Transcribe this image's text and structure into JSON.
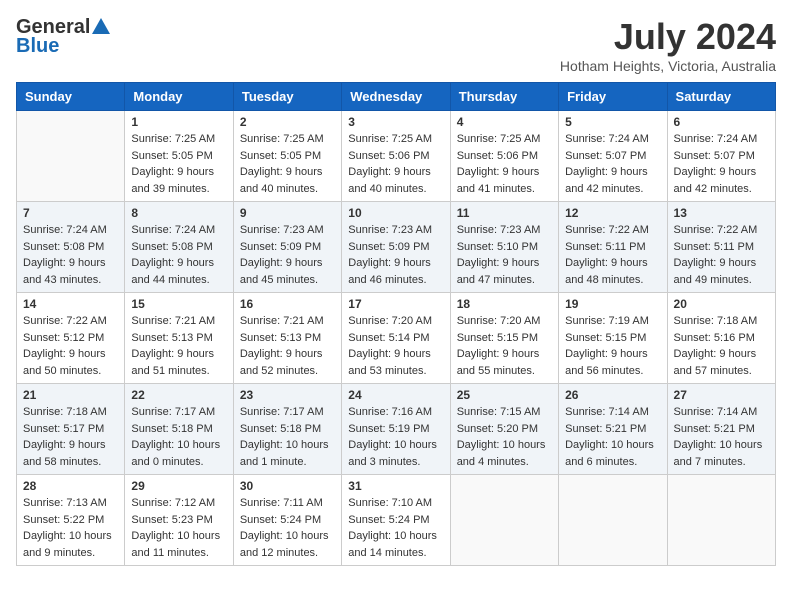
{
  "header": {
    "logo_general": "General",
    "logo_blue": "Blue",
    "month_year": "July 2024",
    "location": "Hotham Heights, Victoria, Australia"
  },
  "days_of_week": [
    "Sunday",
    "Monday",
    "Tuesday",
    "Wednesday",
    "Thursday",
    "Friday",
    "Saturday"
  ],
  "weeks": [
    [
      {
        "day": "",
        "info": ""
      },
      {
        "day": "1",
        "info": "Sunrise: 7:25 AM\nSunset: 5:05 PM\nDaylight: 9 hours\nand 39 minutes."
      },
      {
        "day": "2",
        "info": "Sunrise: 7:25 AM\nSunset: 5:05 PM\nDaylight: 9 hours\nand 40 minutes."
      },
      {
        "day": "3",
        "info": "Sunrise: 7:25 AM\nSunset: 5:06 PM\nDaylight: 9 hours\nand 40 minutes."
      },
      {
        "day": "4",
        "info": "Sunrise: 7:25 AM\nSunset: 5:06 PM\nDaylight: 9 hours\nand 41 minutes."
      },
      {
        "day": "5",
        "info": "Sunrise: 7:24 AM\nSunset: 5:07 PM\nDaylight: 9 hours\nand 42 minutes."
      },
      {
        "day": "6",
        "info": "Sunrise: 7:24 AM\nSunset: 5:07 PM\nDaylight: 9 hours\nand 42 minutes."
      }
    ],
    [
      {
        "day": "7",
        "info": "Sunrise: 7:24 AM\nSunset: 5:08 PM\nDaylight: 9 hours\nand 43 minutes."
      },
      {
        "day": "8",
        "info": "Sunrise: 7:24 AM\nSunset: 5:08 PM\nDaylight: 9 hours\nand 44 minutes."
      },
      {
        "day": "9",
        "info": "Sunrise: 7:23 AM\nSunset: 5:09 PM\nDaylight: 9 hours\nand 45 minutes."
      },
      {
        "day": "10",
        "info": "Sunrise: 7:23 AM\nSunset: 5:09 PM\nDaylight: 9 hours\nand 46 minutes."
      },
      {
        "day": "11",
        "info": "Sunrise: 7:23 AM\nSunset: 5:10 PM\nDaylight: 9 hours\nand 47 minutes."
      },
      {
        "day": "12",
        "info": "Sunrise: 7:22 AM\nSunset: 5:11 PM\nDaylight: 9 hours\nand 48 minutes."
      },
      {
        "day": "13",
        "info": "Sunrise: 7:22 AM\nSunset: 5:11 PM\nDaylight: 9 hours\nand 49 minutes."
      }
    ],
    [
      {
        "day": "14",
        "info": "Sunrise: 7:22 AM\nSunset: 5:12 PM\nDaylight: 9 hours\nand 50 minutes."
      },
      {
        "day": "15",
        "info": "Sunrise: 7:21 AM\nSunset: 5:13 PM\nDaylight: 9 hours\nand 51 minutes."
      },
      {
        "day": "16",
        "info": "Sunrise: 7:21 AM\nSunset: 5:13 PM\nDaylight: 9 hours\nand 52 minutes."
      },
      {
        "day": "17",
        "info": "Sunrise: 7:20 AM\nSunset: 5:14 PM\nDaylight: 9 hours\nand 53 minutes."
      },
      {
        "day": "18",
        "info": "Sunrise: 7:20 AM\nSunset: 5:15 PM\nDaylight: 9 hours\nand 55 minutes."
      },
      {
        "day": "19",
        "info": "Sunrise: 7:19 AM\nSunset: 5:15 PM\nDaylight: 9 hours\nand 56 minutes."
      },
      {
        "day": "20",
        "info": "Sunrise: 7:18 AM\nSunset: 5:16 PM\nDaylight: 9 hours\nand 57 minutes."
      }
    ],
    [
      {
        "day": "21",
        "info": "Sunrise: 7:18 AM\nSunset: 5:17 PM\nDaylight: 9 hours\nand 58 minutes."
      },
      {
        "day": "22",
        "info": "Sunrise: 7:17 AM\nSunset: 5:18 PM\nDaylight: 10 hours\nand 0 minutes."
      },
      {
        "day": "23",
        "info": "Sunrise: 7:17 AM\nSunset: 5:18 PM\nDaylight: 10 hours\nand 1 minute."
      },
      {
        "day": "24",
        "info": "Sunrise: 7:16 AM\nSunset: 5:19 PM\nDaylight: 10 hours\nand 3 minutes."
      },
      {
        "day": "25",
        "info": "Sunrise: 7:15 AM\nSunset: 5:20 PM\nDaylight: 10 hours\nand 4 minutes."
      },
      {
        "day": "26",
        "info": "Sunrise: 7:14 AM\nSunset: 5:21 PM\nDaylight: 10 hours\nand 6 minutes."
      },
      {
        "day": "27",
        "info": "Sunrise: 7:14 AM\nSunset: 5:21 PM\nDaylight: 10 hours\nand 7 minutes."
      }
    ],
    [
      {
        "day": "28",
        "info": "Sunrise: 7:13 AM\nSunset: 5:22 PM\nDaylight: 10 hours\nand 9 minutes."
      },
      {
        "day": "29",
        "info": "Sunrise: 7:12 AM\nSunset: 5:23 PM\nDaylight: 10 hours\nand 11 minutes."
      },
      {
        "day": "30",
        "info": "Sunrise: 7:11 AM\nSunset: 5:24 PM\nDaylight: 10 hours\nand 12 minutes."
      },
      {
        "day": "31",
        "info": "Sunrise: 7:10 AM\nSunset: 5:24 PM\nDaylight: 10 hours\nand 14 minutes."
      },
      {
        "day": "",
        "info": ""
      },
      {
        "day": "",
        "info": ""
      },
      {
        "day": "",
        "info": ""
      }
    ]
  ]
}
